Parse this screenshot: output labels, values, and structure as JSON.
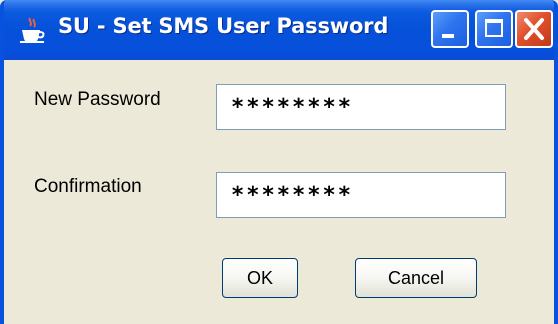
{
  "window": {
    "title": "SU - Set SMS User Password",
    "app_icon": "java-coffee-cup-icon",
    "controls": {
      "minimize": "minimize-icon",
      "maximize": "maximize-icon",
      "close": "close-icon"
    }
  },
  "form": {
    "new_password_label": "New Password",
    "new_password_value": "********",
    "confirmation_label": "Confirmation",
    "confirmation_value": "********"
  },
  "buttons": {
    "ok_label": "OK",
    "cancel_label": "Cancel"
  },
  "colors": {
    "titlebar": "#0551d8",
    "window_bg": "#ece9d8",
    "close_button": "#e0502c"
  }
}
